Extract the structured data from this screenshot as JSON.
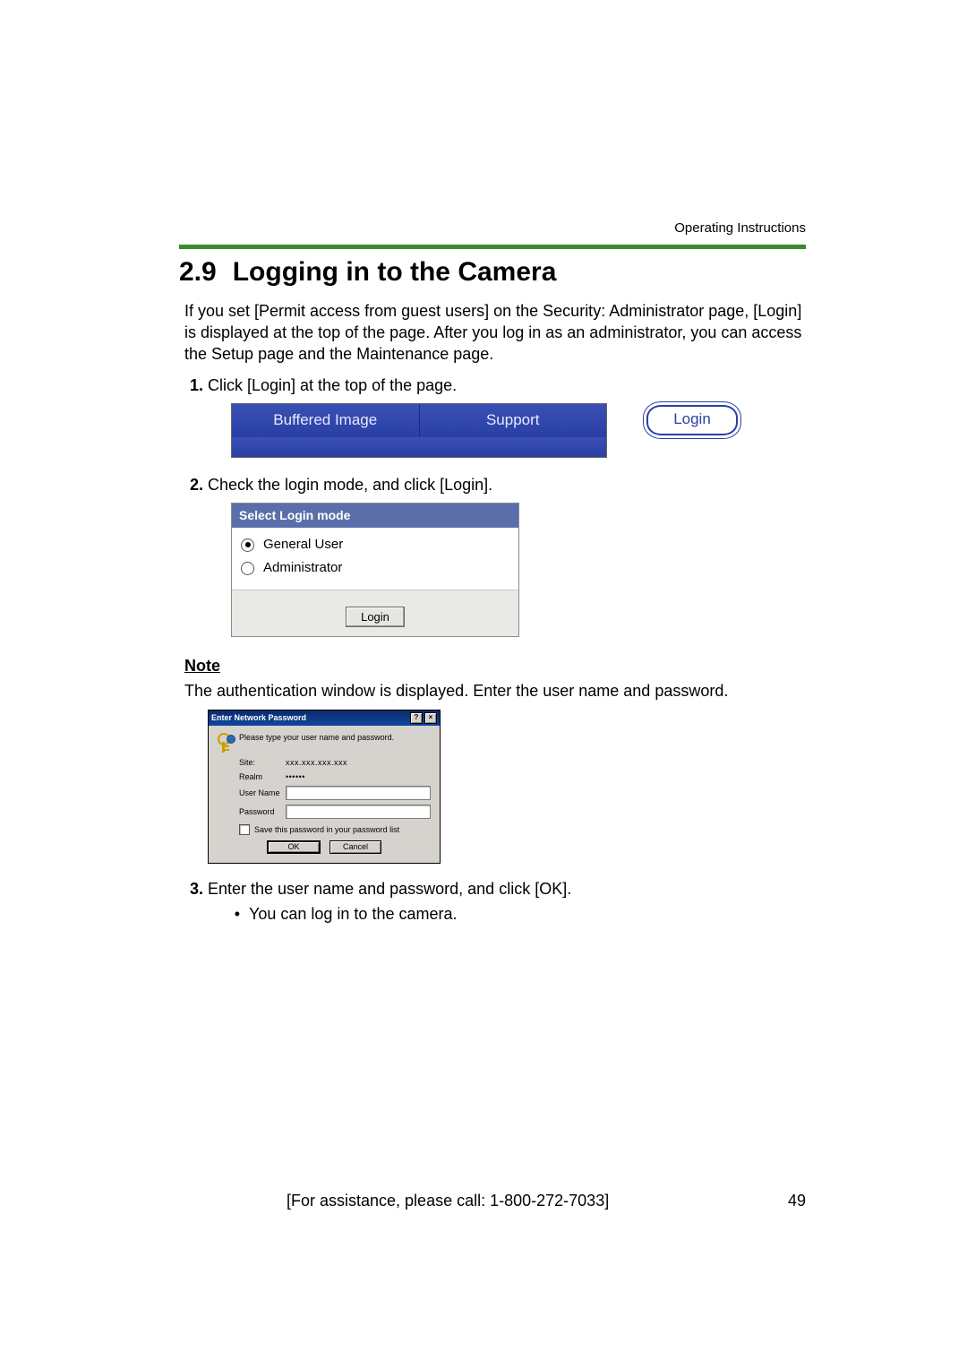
{
  "header_right": "Operating Instructions",
  "section_number": "2.9",
  "section_title": "Logging in to the Camera",
  "intro": "If you set [Permit access from guest users] on the Security: Administrator page, [Login] is displayed at the top of the page. After you log in as an administrator, you can access the Setup page and the Maintenance page.",
  "steps": {
    "s1": "Click [Login] at the top of the page.",
    "s2": "Check the login mode, and click [Login].",
    "s3": "Enter the user name and password, and click [OK].",
    "s3_sub1": "You can log in to the camera."
  },
  "fig1": {
    "tab1": "Buffered Image",
    "tab2": "Support",
    "login_link": "Login"
  },
  "fig2": {
    "header": "Select Login mode",
    "opt1": "General User",
    "opt2": "Administrator",
    "login_btn": "Login"
  },
  "note": {
    "heading": "Note",
    "text": "The authentication window is displayed. Enter the user name and password."
  },
  "fig3": {
    "title": "Enter Network Password",
    "prompt": "Please type your user name and password.",
    "site_label": "Site:",
    "site_value": "xxx.xxx.xxx.xxx",
    "realm_label": "Realm",
    "realm_value": "••••••",
    "user_label": "User Name",
    "pass_label": "Password",
    "save_label": "Save this password in your password list",
    "ok": "OK",
    "cancel": "Cancel",
    "help_btn": "?",
    "close_btn": "×"
  },
  "footer": {
    "assist": "[For assistance, please call: 1-800-272-7033]",
    "page": "49"
  }
}
